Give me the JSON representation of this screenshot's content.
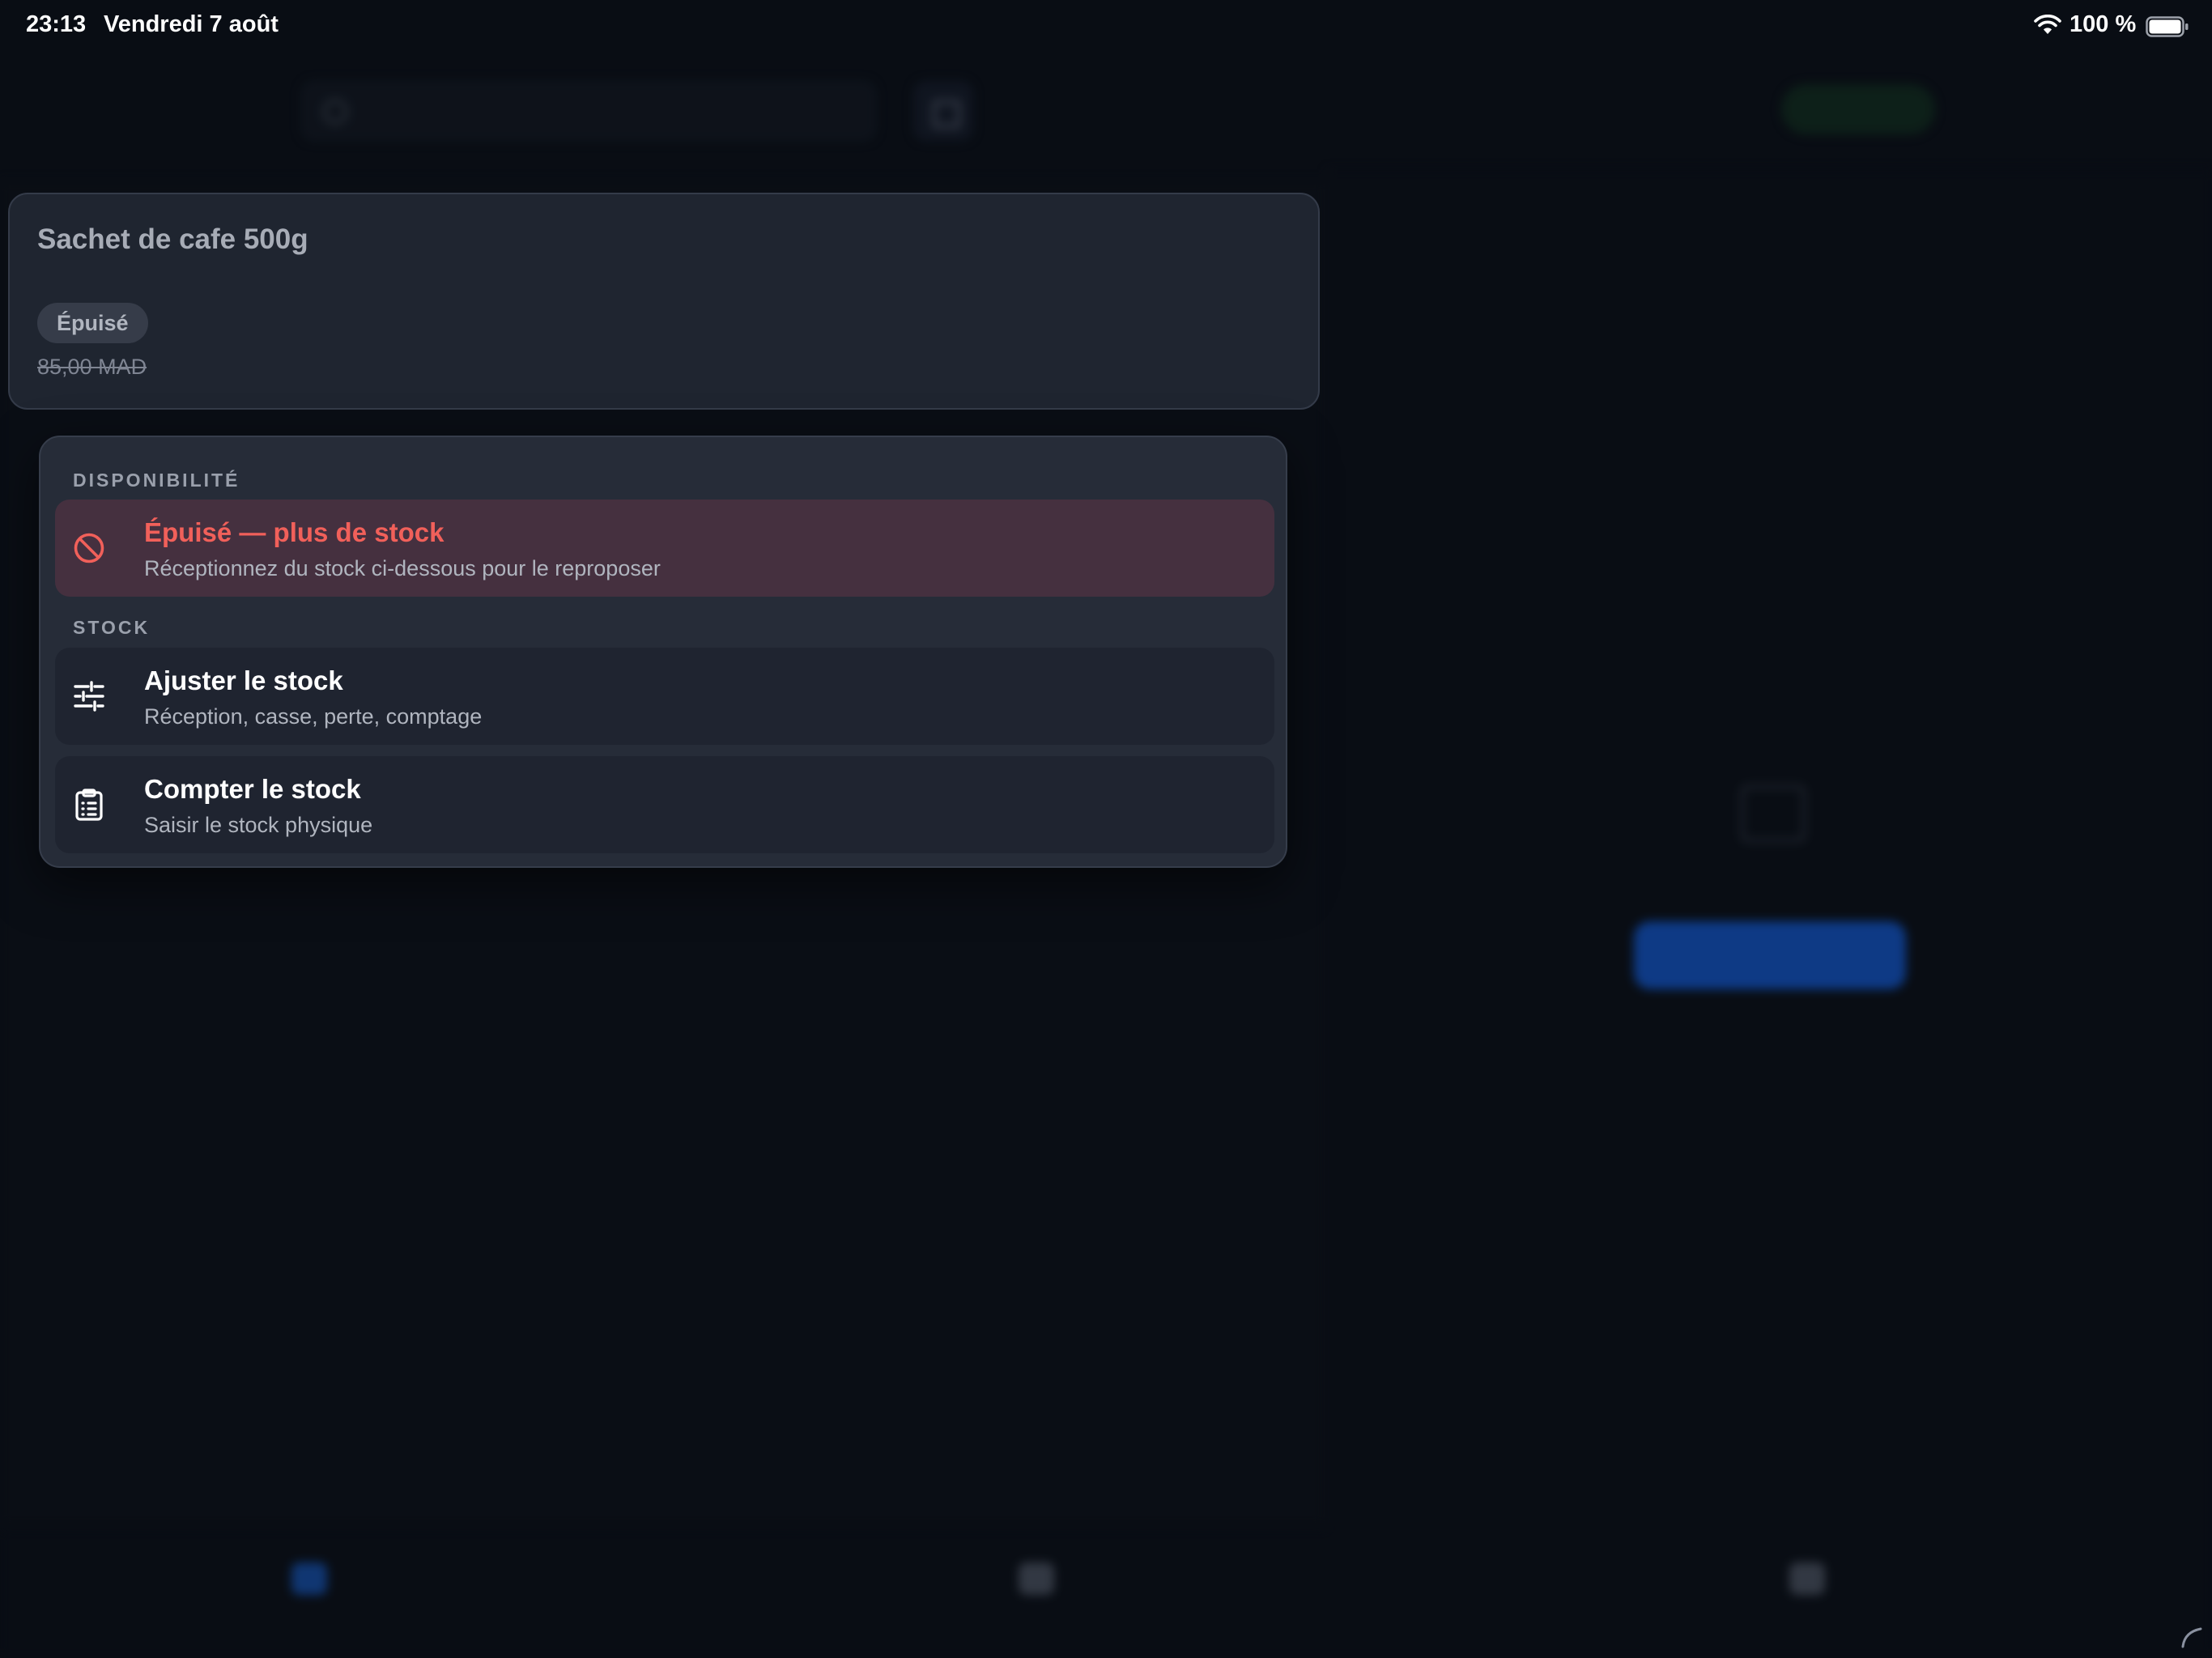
{
  "status_bar": {
    "time": "23:13",
    "date": "Vendredi 7 août",
    "battery": "100 %",
    "wifi_icon": "wifi-icon",
    "battery_icon": "battery-full-icon"
  },
  "product": {
    "name": "Sachet de cafe 500g",
    "badge": "Épuisé",
    "price": "85,00 MAD"
  },
  "menu": {
    "availability_section": "DISPONIBILITÉ",
    "stock_section": "STOCK",
    "items": [
      {
        "icon": "prohibited-icon",
        "title": "Épuisé — plus de stock",
        "subtitle": "Réceptionnez du stock ci-dessous pour le reproposer"
      },
      {
        "icon": "sliders-icon",
        "title": "Ajuster le stock",
        "subtitle": "Réception, casse, perte, comptage"
      },
      {
        "icon": "clipboard-list-icon",
        "title": "Compter le stock",
        "subtitle": "Saisir le stock physique"
      }
    ]
  },
  "colors": {
    "danger": "#f1605a",
    "accent": "#1663e8",
    "background": "#0d111a"
  }
}
